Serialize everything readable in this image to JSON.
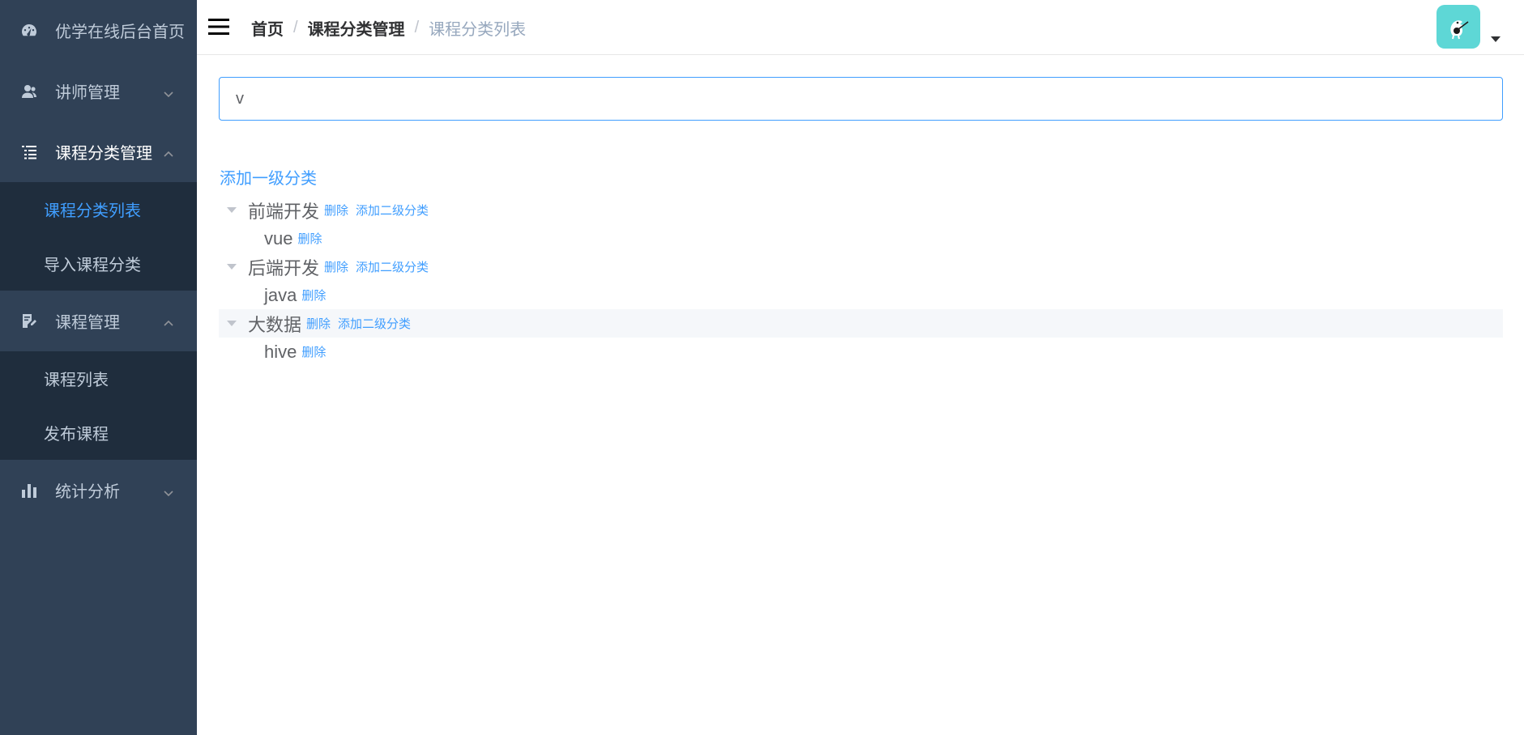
{
  "sidebar": {
    "home": {
      "label": "优学在线后台首页",
      "icon": "dashboard-icon"
    },
    "teacher": {
      "label": "讲师管理",
      "icon": "users-icon"
    },
    "category": {
      "label": "课程分类管理",
      "icon": "tree-list-icon"
    },
    "category_sub": [
      {
        "label": "课程分类列表",
        "active": true
      },
      {
        "label": "导入课程分类",
        "active": false
      }
    ],
    "course": {
      "label": "课程管理",
      "icon": "edit-document-icon"
    },
    "course_sub": [
      {
        "label": "课程列表"
      },
      {
        "label": "发布课程"
      }
    ],
    "stats": {
      "label": "统计分析",
      "icon": "bar-chart-icon"
    }
  },
  "breadcrumb": [
    "首页",
    "课程分类管理",
    "课程分类列表"
  ],
  "breadcrumb_separator": "/",
  "search": {
    "value": "v"
  },
  "actions": {
    "add_root": "添加一级分类"
  },
  "tree": [
    {
      "label": "前端开发",
      "delete": "删除",
      "add_child": "添加二级分类",
      "children": [
        {
          "label": "vue",
          "delete": "删除"
        }
      ]
    },
    {
      "label": "后端开发",
      "delete": "删除",
      "add_child": "添加二级分类",
      "children": [
        {
          "label": "java",
          "delete": "删除"
        }
      ]
    },
    {
      "label": "大数据",
      "delete": "删除",
      "add_child": "添加二级分类",
      "children": [
        {
          "label": "hive",
          "delete": "删除"
        }
      ]
    }
  ],
  "colors": {
    "sidebar_bg": "#304156",
    "submenu_bg": "#1f2d3d",
    "accent": "#409eff",
    "avatar_bg": "#5ed7d6"
  }
}
